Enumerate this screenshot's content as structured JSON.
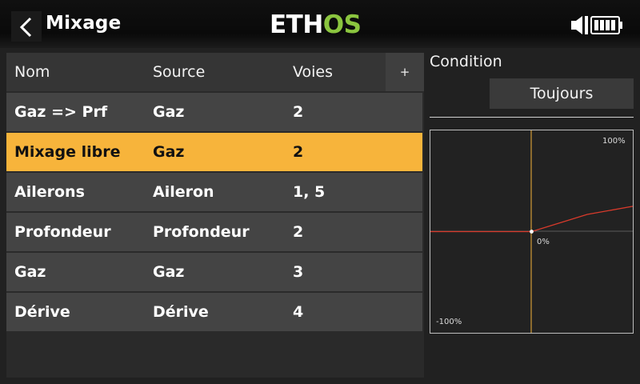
{
  "header": {
    "title": "Mixage",
    "logo_part1": "ETH",
    "logo_part2": "OS"
  },
  "table": {
    "columns": [
      "Nom",
      "Source",
      "Voies"
    ],
    "add_label": "+",
    "rows": [
      {
        "name": "Gaz => Prf",
        "source": "Gaz",
        "channels": "2"
      },
      {
        "name": "Mixage libre",
        "source": "Gaz",
        "channels": "2"
      },
      {
        "name": "Ailerons",
        "source": "Aileron",
        "channels": "1, 5"
      },
      {
        "name": "Profondeur",
        "source": "Profondeur",
        "channels": "2"
      },
      {
        "name": "Gaz",
        "source": "Gaz",
        "channels": "3"
      },
      {
        "name": "Dérive",
        "source": "Dérive",
        "channels": "4"
      }
    ],
    "selected_row": 1
  },
  "condition": {
    "label": "Condition",
    "value": "Toujours"
  },
  "curve": {
    "label_top": "100%",
    "label_center": "0%",
    "label_bottom": "-100%",
    "points": [
      [
        -100,
        0
      ],
      [
        0,
        0
      ],
      [
        55,
        17
      ],
      [
        100,
        25
      ]
    ]
  },
  "colors": {
    "accent": "#f7b43b",
    "logo_green": "#8bc53f",
    "curve": "#d93a2b"
  }
}
